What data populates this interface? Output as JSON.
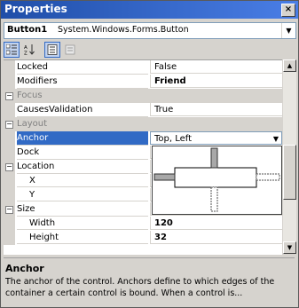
{
  "window": {
    "title": "Properties",
    "close_glyph": "×"
  },
  "object_selector": {
    "name": "Button1",
    "type": "System.Windows.Forms.Button",
    "dropdown_glyph": "▼"
  },
  "toolbar": {
    "buttons": [
      "categorized-icon",
      "alphabetical-icon",
      "properties-icon",
      "events-icon"
    ]
  },
  "grid": {
    "rows": [
      {
        "kind": "prop",
        "name": "Locked",
        "value": "False"
      },
      {
        "kind": "prop",
        "name": "Modifiers",
        "value": "Friend",
        "bold": true
      },
      {
        "kind": "cat",
        "name": "Focus",
        "toggle": "−"
      },
      {
        "kind": "prop",
        "name": "CausesValidation",
        "value": "True"
      },
      {
        "kind": "cat",
        "name": "Layout",
        "toggle": "−"
      },
      {
        "kind": "prop",
        "name": "Anchor",
        "value": "Top, Left",
        "selected": true
      },
      {
        "kind": "prop",
        "name": "Dock",
        "value": ""
      },
      {
        "kind": "sub",
        "name": "Location",
        "toggle": "−"
      },
      {
        "kind": "prop",
        "name": "X",
        "value": "",
        "indent": true
      },
      {
        "kind": "prop",
        "name": "Y",
        "value": "",
        "indent": true
      },
      {
        "kind": "sub",
        "name": "Size",
        "toggle": "−"
      },
      {
        "kind": "prop",
        "name": "Width",
        "value": "120",
        "indent": true,
        "bold": true
      },
      {
        "kind": "prop",
        "name": "Height",
        "value": "32",
        "indent": true,
        "bold": true
      }
    ]
  },
  "anchor_dropdown_glyph": "▼",
  "scrollbar": {
    "up": "▲",
    "down": "▼"
  },
  "description": {
    "title": "Anchor",
    "text": "The anchor of the control. Anchors define to which edges of the container a certain control is bound. When a control is..."
  }
}
